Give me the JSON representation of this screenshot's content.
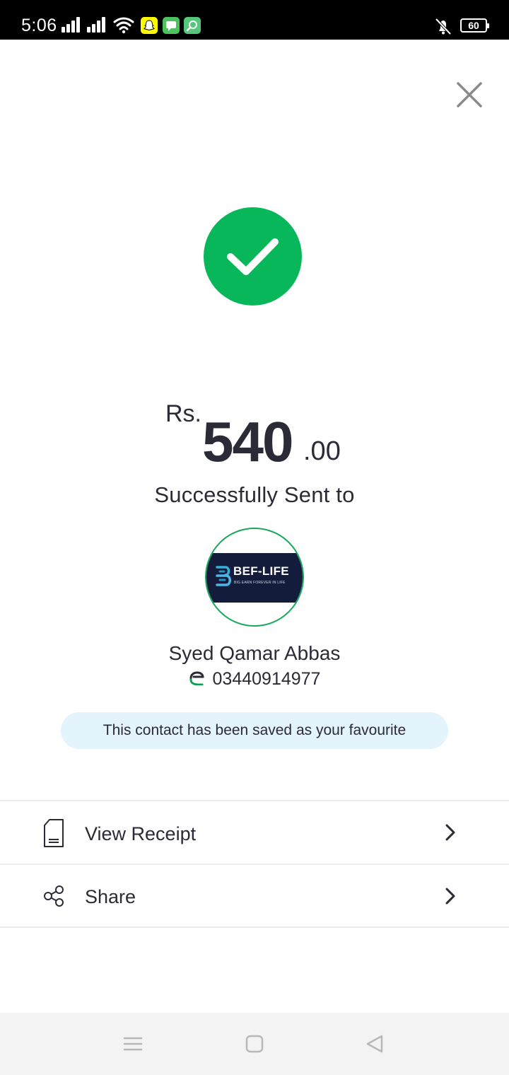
{
  "status_bar": {
    "time": "5:06",
    "battery": "60"
  },
  "colors": {
    "success_green": "#08b75a",
    "text_dark": "#2b2b38",
    "pill_bg": "#e3f4fd",
    "avatar_border": "#18a75a"
  },
  "amount": {
    "currency": "Rs.",
    "main": "540",
    "decimal": ".00"
  },
  "status_text": "Successfully Sent to",
  "contact": {
    "logo_text": "BEF-LIFE",
    "logo_subtext": "BIG EARN FOREVER IN LIFE",
    "name": "Syed Qamar Abbas",
    "phone": "03440914977",
    "favourite_note": "This contact has been saved as your favourite"
  },
  "actions": [
    {
      "label": "View Receipt",
      "icon": "receipt-icon"
    },
    {
      "label": "Share",
      "icon": "share-icon"
    }
  ],
  "icons": {
    "close": "close-icon",
    "success": "checkmark-icon",
    "wallet": "wallet-icon",
    "chevron": "chevron-right-icon",
    "nav_menu": "menu-icon",
    "nav_home": "home-icon",
    "nav_back": "back-icon"
  }
}
